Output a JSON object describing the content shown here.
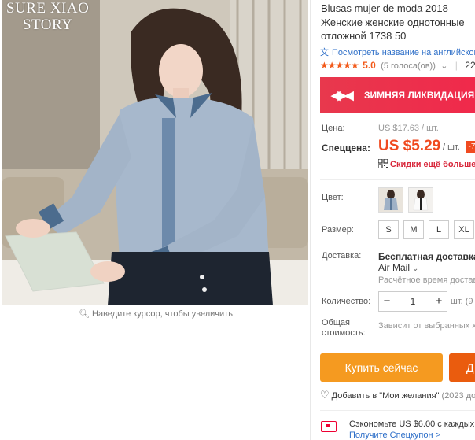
{
  "brand": {
    "line1": "SURE XIAO",
    "line2": "STORY"
  },
  "image": {
    "zoom_hint": "Наведите курсор, чтобы увеличить"
  },
  "product": {
    "title": "Blusas mujer de moda 2018 Женские женские однотонные отложной 1738 50",
    "translate_link": "Посмотреть название на английском",
    "rating": {
      "stars": "★★★★★",
      "score": "5.0",
      "votes": "(5 голоса(ов))",
      "orders": "22 з"
    }
  },
  "promo": {
    "text": "ЗИМНЯЯ ЛИКВИДАЦИЯ"
  },
  "price": {
    "label": "Цена:",
    "old": "US $17.63 / шт.",
    "special_label": "Спеццена:",
    "special": "US $5.29",
    "unit": "/ шт.",
    "badge": "-7",
    "discount_text": "Скидки ещё больше в"
  },
  "color": {
    "label": "Цвет:",
    "options": [
      "Серо-голубой",
      "Белый"
    ]
  },
  "size": {
    "label": "Размер:",
    "options": [
      "S",
      "M",
      "L",
      "XL"
    ]
  },
  "delivery": {
    "label": "Доставка:",
    "free": "Бесплатная доставка в",
    "method": "Air Mail",
    "eta": "Расчётное время доставки"
  },
  "quantity": {
    "label": "Количество:",
    "value": "1",
    "minus": "−",
    "plus": "+",
    "unit": "шт. (9"
  },
  "total": {
    "label": "Общая стоимость:",
    "note": "Зависит от выбранных ха"
  },
  "actions": {
    "buy_now": "Купить сейчас",
    "add_cart": "Д"
  },
  "wishlist": {
    "text": "Добавить в \"Мои желания\"",
    "count": "(2023 до"
  },
  "coupon": {
    "text": "Сэкономьте US $6.00 с каждых U",
    "link": "Получите Спецкупон >"
  }
}
